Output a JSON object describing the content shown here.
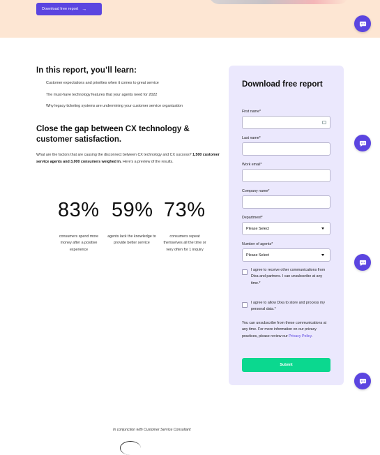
{
  "hero": {
    "download_button": "Download free report",
    "arrow": "→"
  },
  "learn": {
    "title": "In this report, you’ll learn:",
    "items": [
      "Customer expectations and priorities when it comes to great service",
      "The must-have technology features that your agents need for 2022",
      "Why legacy ticketing systems are undermining your customer service organization"
    ]
  },
  "gap": {
    "title": "Close the gap between CX technology & customer satisfaction.",
    "text_before": "What are the factors that are causing the disconnect between CX technology and CX success? ",
    "text_bold": "1,500 customer service agents and 3,000 consumers weighed in.",
    "text_after": " Here’s a preview of the results."
  },
  "stats": [
    {
      "value": "83%",
      "label": "consumers spend more money after a positive experience"
    },
    {
      "value": "59%",
      "label": "agents lack the knowledge to provide better service"
    },
    {
      "value": "73%",
      "label": "consumers repeat themselves all the time or very often for 1 inquiry"
    }
  ],
  "form": {
    "title": "Download free report",
    "first_name": "First name*",
    "last_name": "Last name*",
    "work_email": "Work email*",
    "company_name": "Company name*",
    "department": "Department*",
    "department_value": "Please Select",
    "agents": "Number of agents*",
    "agents_value": "Please Select",
    "consent_comms": "I agree to receive other communications from Dixa and partners. I can unsubscribe at any time.*",
    "consent_store": "I agree to allow Dixa to store and process my personal data.*",
    "note_text": "You can unsubscribe from these communications at any time. For more information on our privacy practices, please review our ",
    "privacy_link": "Privacy Policy",
    "note_end": ".",
    "submit": "Submit"
  },
  "footer": {
    "conjunction": "In conjunction with Customer Service Consultant"
  },
  "colors": {
    "accent": "#5b45e0",
    "submit": "#0bd88f",
    "hero_bg": "#fde6d3",
    "form_bg": "#ebe8fd"
  },
  "icons": {
    "chat": "chat-bubble-icon",
    "dropdown": "caret-down-icon",
    "autofill": "contact-card-icon"
  }
}
